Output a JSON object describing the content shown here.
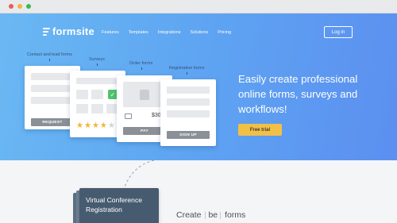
{
  "browser": {
    "buttons": [
      "close",
      "minimize",
      "maximize"
    ]
  },
  "header": {
    "logo_text": "formsite",
    "nav": [
      "Features",
      "Templates",
      "Integrations",
      "Solutions",
      "Pricing"
    ],
    "login_label": "Log in"
  },
  "hero": {
    "headline": "Easily create professional online forms, surveys and workflows!",
    "cta_label": "Free trial",
    "colors": {
      "gradient_start": "#6ab8f3",
      "gradient_end": "#5b8ff0",
      "cta": "#f2c045"
    }
  },
  "form_cards": {
    "contact": {
      "label": "Contact and lead forms",
      "button": "REQUEST"
    },
    "surveys": {
      "label": "Surveys",
      "rating_stars": 5,
      "rating_filled": 4
    },
    "order": {
      "label": "Order forms",
      "price": "$300",
      "button": "PAY"
    },
    "registration": {
      "label": "Registration forms",
      "button": "SIGN UP"
    }
  },
  "lower": {
    "template_card_title": "Virtual Conference Registration",
    "create_prefix": "Create",
    "create_middle": "be",
    "create_suffix": "forms"
  }
}
